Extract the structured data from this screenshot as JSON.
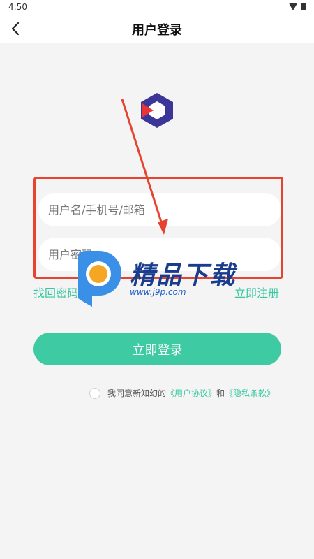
{
  "status_bar": {
    "time": "4:50"
  },
  "header": {
    "title": "用户登录"
  },
  "form": {
    "username_placeholder": "用户名/手机号/邮箱",
    "password_placeholder": "用户密码"
  },
  "links": {
    "forgot": "找回密码",
    "register": "立即注册"
  },
  "login_button": "立即登录",
  "agreement": {
    "prefix": "我同意新知幻的",
    "user_agreement": "《用户协议》",
    "conjunction": "和",
    "privacy": "《隐私条款》"
  },
  "watermark": {
    "text": "精品下载",
    "url": "www.j9p.com"
  },
  "colors": {
    "accent": "#3ecba3",
    "highlight_box": "#e64330",
    "background": "#f4f4f4"
  }
}
